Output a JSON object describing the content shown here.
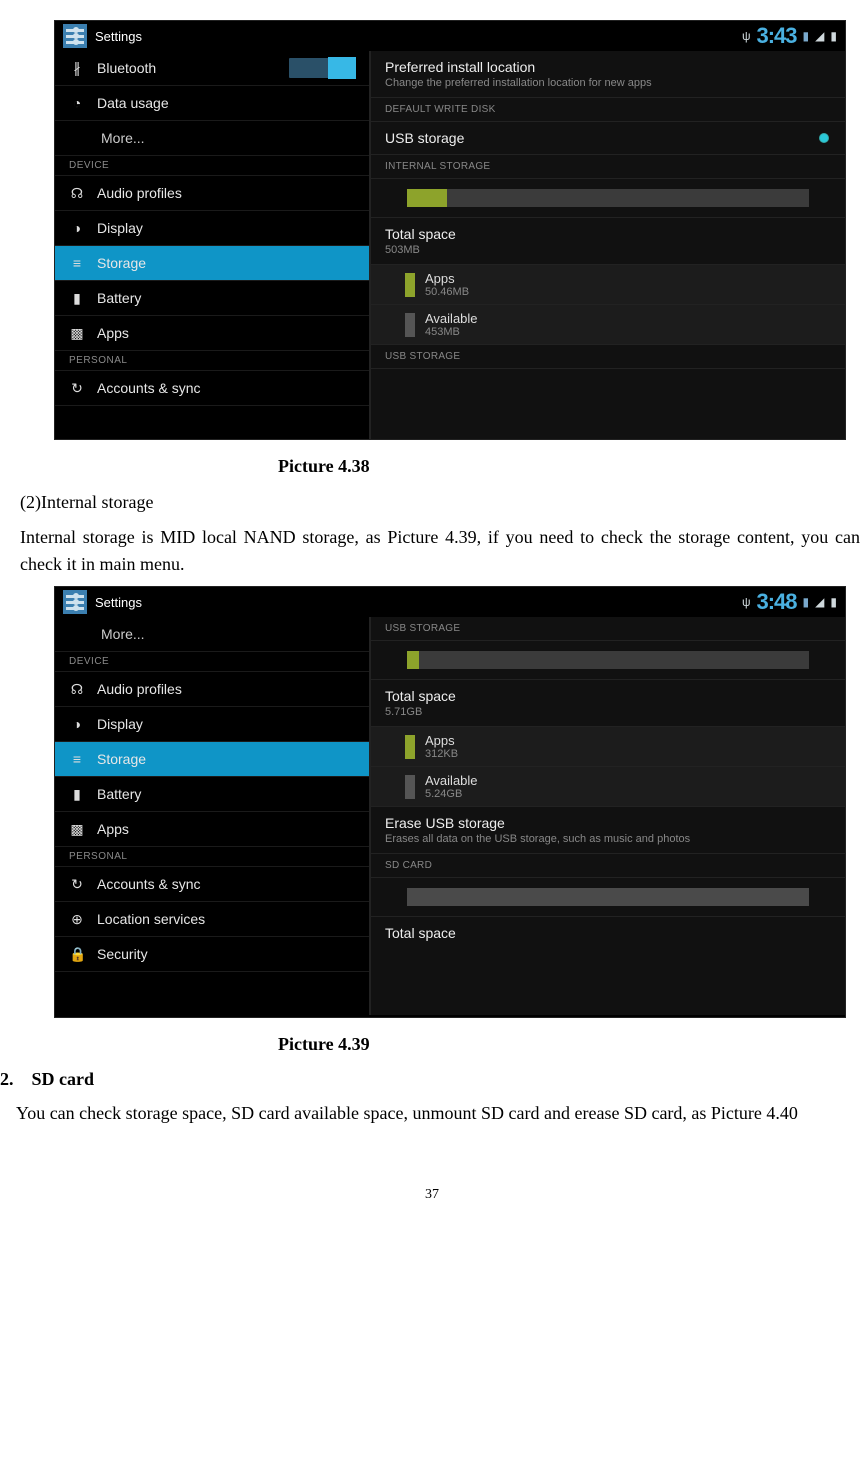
{
  "captions": {
    "p438": "Picture 4.38",
    "p439": "Picture 4.39"
  },
  "text": {
    "sub_heading": "(2)Internal storage",
    "para1": "Internal storage is MID local NAND storage, as Picture 4.39, if you need to check the storage content, you can check it in main menu.",
    "sd_num": "2.",
    "sd_title": "SD card",
    "sd_para": "You can check storage space, SD card available space, unmount SD card and erease SD card, as Picture 4.40",
    "page_num": "37"
  },
  "shot1": {
    "app_title": "Settings",
    "clock": "3:43",
    "toggle_on": "ON",
    "side": {
      "bluetooth": "Bluetooth",
      "data_usage": "Data usage",
      "more": "More...",
      "device_hdr": "DEVICE",
      "audio": "Audio profiles",
      "display": "Display",
      "storage": "Storage",
      "battery": "Battery",
      "apps": "Apps",
      "personal_hdr": "PERSONAL",
      "accounts": "Accounts & sync"
    },
    "det": {
      "pref_title": "Preferred install location",
      "pref_sub": "Change the preferred installation location for new apps",
      "def_write": "DEFAULT WRITE DISK",
      "usb_storage": "USB storage",
      "internal_hdr": "INTERNAL STORAGE",
      "total_t": "Total space",
      "total_v": "503MB",
      "apps_t": "Apps",
      "apps_v": "50.46MB",
      "avail_t": "Available",
      "avail_v": "453MB",
      "usb_hdr": "USB STORAGE"
    }
  },
  "shot2": {
    "app_title": "Settings",
    "clock": "3:48",
    "side": {
      "more": "More...",
      "device_hdr": "DEVICE",
      "audio": "Audio profiles",
      "display": "Display",
      "storage": "Storage",
      "battery": "Battery",
      "apps": "Apps",
      "personal_hdr": "PERSONAL",
      "accounts": "Accounts & sync",
      "location": "Location services",
      "security": "Security"
    },
    "det": {
      "usb_hdr": "USB STORAGE",
      "total_t": "Total space",
      "total_v": "5.71GB",
      "apps_t": "Apps",
      "apps_v": "312KB",
      "avail_t": "Available",
      "avail_v": "5.24GB",
      "erase_t": "Erase USB storage",
      "erase_s": "Erases all data on the USB storage, such as music and photos",
      "sd_hdr": "SD CARD",
      "total2_t": "Total space"
    }
  }
}
